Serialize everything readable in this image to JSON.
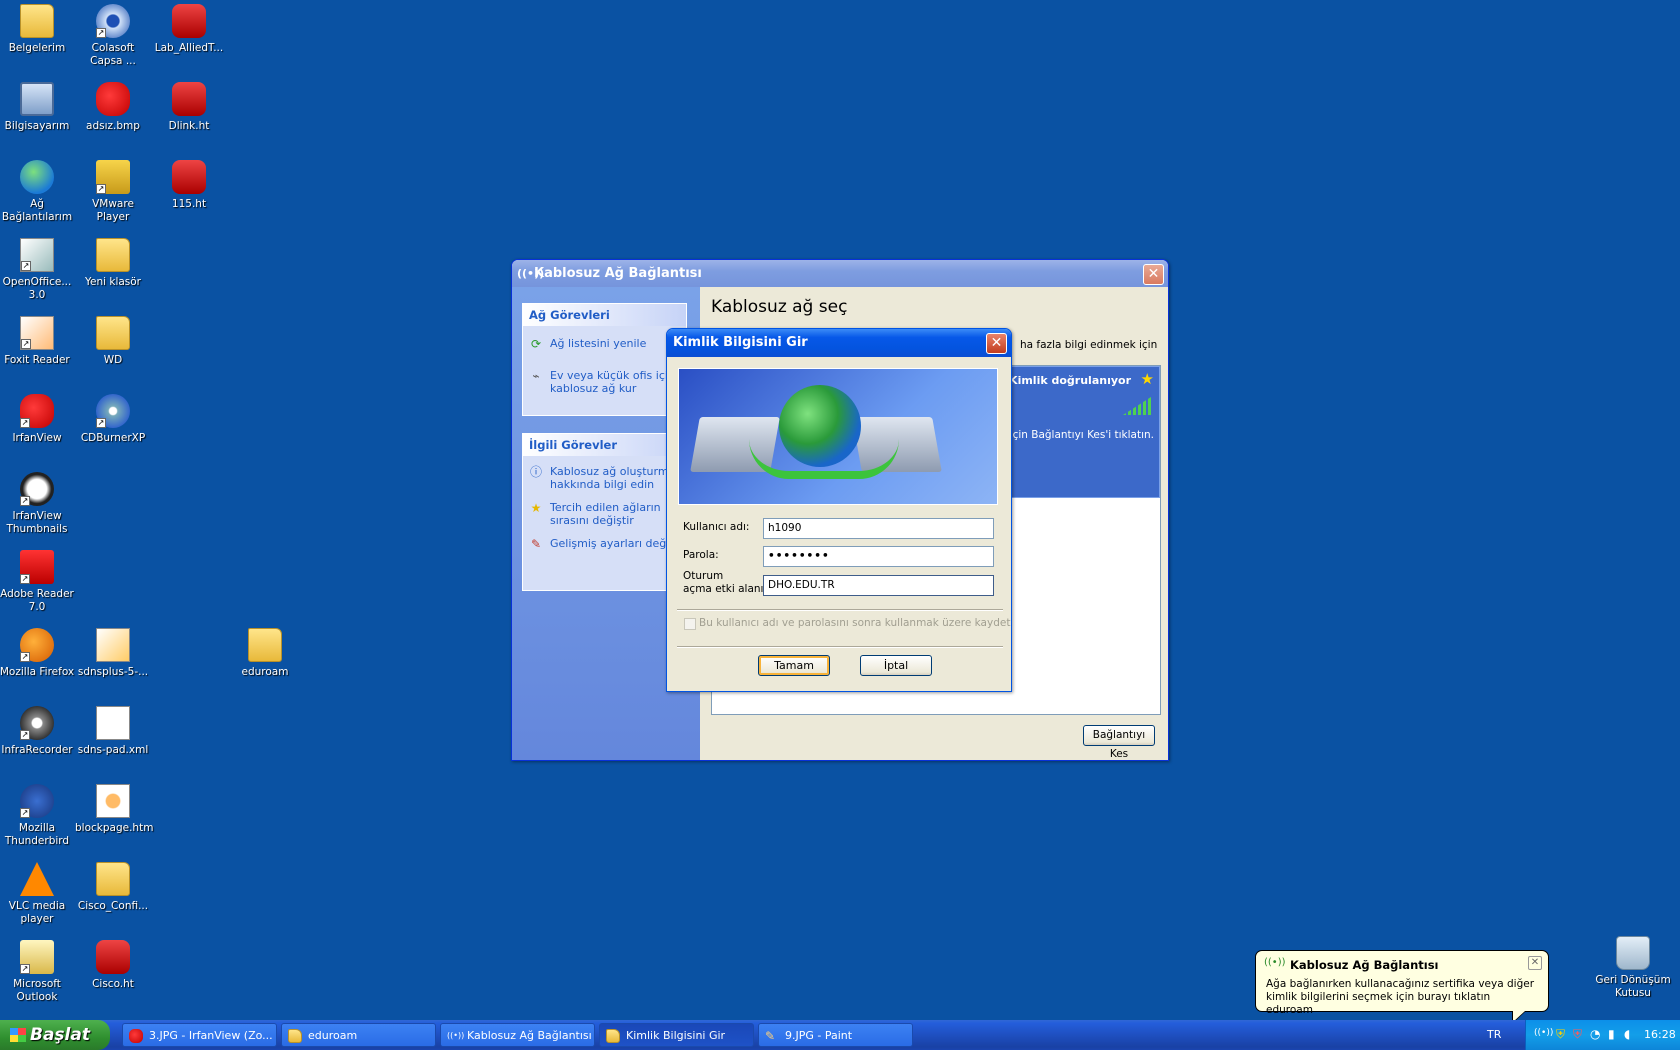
{
  "desktop_icons": [
    {
      "label": "Belgelerim"
    },
    {
      "label": "Colasoft Capsa ..."
    },
    {
      "label": "Lab_AlliedT..."
    },
    {
      "label": "Bilgisayarım"
    },
    {
      "label": "adsız.bmp"
    },
    {
      "label": "Dlink.ht"
    },
    {
      "label": "Ağ Bağlantılarım"
    },
    {
      "label": "VMware Player"
    },
    {
      "label": "115.ht"
    },
    {
      "label": "OpenOffice... 3.0"
    },
    {
      "label": "Yeni klasör"
    },
    {
      "label": "Foxit Reader"
    },
    {
      "label": "WD"
    },
    {
      "label": "IrfanView"
    },
    {
      "label": "CDBurnerXP"
    },
    {
      "label": "IrfanView Thumbnails"
    },
    {
      "label": "Adobe Reader 7.0"
    },
    {
      "label": "Mozilla Firefox"
    },
    {
      "label": "sdnsplus-5-..."
    },
    {
      "label": "eduroam"
    },
    {
      "label": "InfraRecorder"
    },
    {
      "label": "sdns-pad.xml"
    },
    {
      "label": "Mozilla Thunderbird"
    },
    {
      "label": "blockpage.htm"
    },
    {
      "label": "VLC media player"
    },
    {
      "label": "Cisco_Confi..."
    },
    {
      "label": "Microsoft Outlook"
    },
    {
      "label": "Cisco.ht"
    },
    {
      "label": "Geri Dönüşüm Kutusu"
    }
  ],
  "wireless_window": {
    "title": "Kablosuz Ağ Bağlantısı",
    "heading": "Kablosuz ağ seç",
    "info_fragment": "ha fazla bilgi edinmek için",
    "network_status": "Kimlik doğrulanıyor",
    "network_hint": "k için Bağlantıyı Kes'i tıklatın.",
    "disconnect_label": "Bağlantıyı Kes",
    "tasks_header": "Ağ Görevleri",
    "tasks": [
      "Ağ listesini yenile",
      "Ev veya küçük ofis için kablosuz ağ kur"
    ],
    "related_header": "İlgili Görevler",
    "related": [
      "Kablosuz ağ oluşturma hakkında bilgi edin",
      "Tercih edilen ağların sırasını değiştir",
      "Gelişmiş ayarları değiştir"
    ]
  },
  "credentials_dialog": {
    "title": "Kimlik Bilgisini Gir",
    "username_label": "Kullanıcı adı:",
    "username_value": "h1090",
    "password_label": "Parola:",
    "password_value": "••••••••",
    "domain_label_1": "Oturum",
    "domain_label_2": "açma etki alanı:",
    "domain_value": "DHO.EDU.TR",
    "save_label": "Bu kullanıcı adı ve parolasını sonra kullanmak üzere kaydet",
    "ok_label": "Tamam",
    "cancel_label": "İptal"
  },
  "taskbar": {
    "start_label": "Başlat",
    "buttons": [
      "3.JPG - IrfanView (Zo...",
      "eduroam",
      "Kablosuz Ağ Bağlantısı",
      "Kimlik Bilgisini Gir",
      "9.JPG - Paint"
    ],
    "lang": "TR",
    "clock": "16:28"
  },
  "balloon": {
    "title": "Kablosuz Ağ Bağlantısı",
    "text": "Ağa bağlanırken kullanacağınız sertifika veya diğer kimlik bilgilerini seçmek için burayı tıklatın eduroam"
  }
}
